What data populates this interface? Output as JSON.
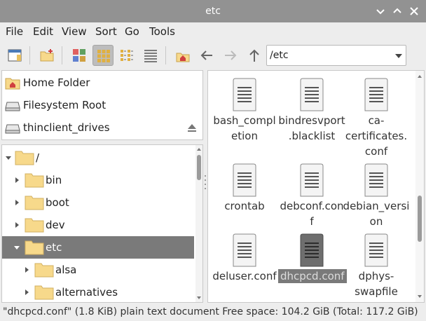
{
  "window": {
    "title": "etc"
  },
  "menu": {
    "items": [
      "File",
      "Edit",
      "View",
      "Sort",
      "Go",
      "Tools"
    ]
  },
  "toolbar": {
    "path_value": "/etc"
  },
  "places": [
    {
      "label": "Home Folder",
      "icon": "home-icon"
    },
    {
      "label": "Filesystem Root",
      "icon": "drive-icon"
    },
    {
      "label": "thinclient_drives",
      "icon": "drive-icon"
    }
  ],
  "tree": [
    {
      "label": "/",
      "level": 0,
      "expanded": true
    },
    {
      "label": "bin",
      "level": 1
    },
    {
      "label": "boot",
      "level": 1
    },
    {
      "label": "dev",
      "level": 1
    },
    {
      "label": "etc",
      "level": 1,
      "expanded": true,
      "selected": true
    },
    {
      "label": "alsa",
      "level": 2
    },
    {
      "label": "alternatives",
      "level": 2
    }
  ],
  "files": [
    {
      "line1": "bash_compl",
      "line2": "etion",
      "line3": ""
    },
    {
      "line1": "bindresvport",
      "line2": ".blacklist",
      "line3": ""
    },
    {
      "line1": "ca-",
      "line2": "certificates.",
      "line3": "conf"
    },
    {
      "line1": "crontab",
      "line2": "",
      "line3": ""
    },
    {
      "line1": "debconf.con",
      "line2": "f",
      "line3": ""
    },
    {
      "line1": "debian_versi",
      "line2": "on",
      "line3": ""
    },
    {
      "line1": "deluser.conf",
      "line2": "",
      "line3": ""
    },
    {
      "line1": "dhcpcd.conf",
      "line2": "",
      "line3": "",
      "selected": true
    },
    {
      "line1": "dphys-",
      "line2": "swapfile",
      "line3": ""
    }
  ],
  "status": {
    "text": "\"dhcpcd.conf\" (1.8 KiB) plain text document Free space: 104.2 GiB (Total: 117.2 GiB)"
  },
  "colors": {
    "selection": "#7a7a7a",
    "titlebar": "#929292",
    "folder": "#f7d98b"
  }
}
